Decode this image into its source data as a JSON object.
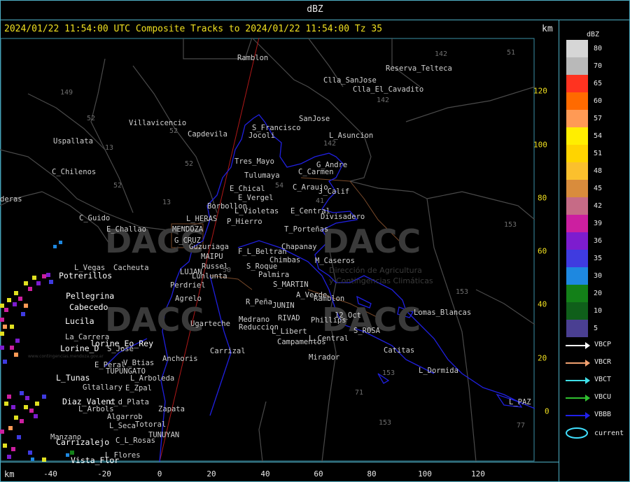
{
  "window": {
    "title": "dBZ"
  },
  "header": {
    "title": "2024/01/22 11:54:00 UTC Composite Tracks to 2024/01/22 11:54:00 Tz 35",
    "unit": "km"
  },
  "axes": {
    "x_unit": "km",
    "x_ticks": [
      "-40",
      "-20",
      "0",
      "20",
      "40",
      "60",
      "80",
      "100",
      "120"
    ],
    "y_ticks": [
      "120",
      "100",
      "80",
      "60",
      "40",
      "20",
      "0"
    ]
  },
  "legend": {
    "unit": "dBZ",
    "scale": [
      {
        "label": "80",
        "color": "#d6d6d6"
      },
      {
        "label": "70",
        "color": "#b9b9b9"
      },
      {
        "label": "65",
        "color": "#ff3320"
      },
      {
        "label": "60",
        "color": "#ff6a00"
      },
      {
        "label": "57",
        "color": "#ff9a55"
      },
      {
        "label": "54",
        "color": "#ffee00"
      },
      {
        "label": "51",
        "color": "#ffd400"
      },
      {
        "label": "48",
        "color": "#fbc02d"
      },
      {
        "label": "45",
        "color": "#d98c3c"
      },
      {
        "label": "42",
        "color": "#c66b86"
      },
      {
        "label": "39",
        "color": "#cc1fa0"
      },
      {
        "label": "36",
        "color": "#7d1ccf"
      },
      {
        "label": "35",
        "color": "#3f3be0"
      },
      {
        "label": "30",
        "color": "#1e88e0"
      },
      {
        "label": "20",
        "color": "#138018"
      },
      {
        "label": "10",
        "color": "#0f5f1a"
      },
      {
        "label": "5",
        "color": "#4a3f92"
      }
    ],
    "tracks": [
      {
        "label": "VBCP",
        "color": "#ffffff"
      },
      {
        "label": "VBCR",
        "color": "#f0a070"
      },
      {
        "label": "VBCT",
        "color": "#40e0e8"
      },
      {
        "label": "VBCU",
        "color": "#30c030"
      },
      {
        "label": "VBBB",
        "color": "#2020e8"
      }
    ],
    "current": {
      "label": "current",
      "color": "#40e0ff"
    }
  },
  "watermarks": {
    "name": "DACC",
    "line1": "Dirección de Agricultura",
    "line2": "y Contingencias Climáticas",
    "url": "www.contingencias.mendoza.gov.ar"
  },
  "places": [
    {
      "name": "Ramblon"
    },
    {
      "name": "Reserva_Telteca"
    },
    {
      "name": "Clla_SanJose"
    },
    {
      "name": "Clla_El_Cavadito"
    },
    {
      "name": "Villavicencio"
    },
    {
      "name": "Capdevila"
    },
    {
      "name": "SanJose"
    },
    {
      "name": "S_Francisco"
    },
    {
      "name": "Jocoli"
    },
    {
      "name": "L_Asuncion"
    },
    {
      "name": "Uspallata"
    },
    {
      "name": "Tres_Mayo"
    },
    {
      "name": "G_Andre"
    },
    {
      "name": "C_Carmen"
    },
    {
      "name": "Tulumaya"
    },
    {
      "name": "C_Chilenos"
    },
    {
      "name": "E_Chical"
    },
    {
      "name": "E_Vergel"
    },
    {
      "name": "C_Araujo"
    },
    {
      "name": "J_Calif"
    },
    {
      "name": "deras"
    },
    {
      "name": "Borbollon"
    },
    {
      "name": "L_Violetas"
    },
    {
      "name": "E_Central"
    },
    {
      "name": "C_Guido"
    },
    {
      "name": "L_HERAS"
    },
    {
      "name": "P_Hierro"
    },
    {
      "name": "Divisadero"
    },
    {
      "name": "E_Challao"
    },
    {
      "name": "MENDOZA"
    },
    {
      "name": "T_Porteñas"
    },
    {
      "name": "G_CRUZ"
    },
    {
      "name": "Guzuriaga"
    },
    {
      "name": "Chapanay"
    },
    {
      "name": "MAIPU"
    },
    {
      "name": "F_L_Beltran"
    },
    {
      "name": "Chimbas"
    },
    {
      "name": "Potrerillos"
    },
    {
      "name": "Russel"
    },
    {
      "name": "M_Caseros"
    },
    {
      "name": "L_Vegas"
    },
    {
      "name": "Cacheuta"
    },
    {
      "name": "LUJAN"
    },
    {
      "name": "S_Roque"
    },
    {
      "name": "Lunlunta"
    },
    {
      "name": "Palmira"
    },
    {
      "name": "Perdriel"
    },
    {
      "name": "S_MARTIN"
    },
    {
      "name": "Pellegrina"
    },
    {
      "name": "Agrelo"
    },
    {
      "name": "A_Verde"
    },
    {
      "name": "Ramblon"
    },
    {
      "name": "Cabecedo"
    },
    {
      "name": "R_Peña"
    },
    {
      "name": "JUNIN"
    },
    {
      "name": "Lomas_Blancas"
    },
    {
      "name": "Lucila"
    },
    {
      "name": "Medrano"
    },
    {
      "name": "RIVAD"
    },
    {
      "name": "12_Oct"
    },
    {
      "name": "Ugarteche"
    },
    {
      "name": "Reduccion"
    },
    {
      "name": "Phillips"
    },
    {
      "name": "S_ROSA"
    },
    {
      "name": "L_Libert"
    },
    {
      "name": "La_Carrera"
    },
    {
      "name": "L_Central"
    },
    {
      "name": "Campamentos"
    },
    {
      "name": "Lorine_D"
    },
    {
      "name": "lorine_Eo_Rey"
    },
    {
      "name": "S_Jose"
    },
    {
      "name": "Carrizal"
    },
    {
      "name": "Catitas"
    },
    {
      "name": "Mirador"
    },
    {
      "name": "E_Peral"
    },
    {
      "name": "V_Btias"
    },
    {
      "name": "Anchoris"
    },
    {
      "name": "TUPUNGATO"
    },
    {
      "name": "L_Dormida"
    },
    {
      "name": "L_Tunas"
    },
    {
      "name": "L_Arboleda"
    },
    {
      "name": "Gltallary"
    },
    {
      "name": "E_Zpal"
    },
    {
      "name": "Diaz_Valent"
    },
    {
      "name": "c_d_Plata"
    },
    {
      "name": "L_Arbols"
    },
    {
      "name": "Zapata"
    },
    {
      "name": "L_PAZ"
    },
    {
      "name": "Algarrob"
    },
    {
      "name": "Manzano"
    },
    {
      "name": "L_Seca"
    },
    {
      "name": "Totoral"
    },
    {
      "name": "Carrizalejo"
    },
    {
      "name": "C_L_Rosas"
    },
    {
      "name": "TUNUYAN"
    },
    {
      "name": "L_Flores"
    },
    {
      "name": "Vista_Flor"
    }
  ],
  "numbers": [
    "142",
    "51",
    "149",
    "142",
    "52",
    "52",
    "13",
    "142",
    "52",
    "52",
    "13",
    "54",
    "41",
    "153",
    "50",
    "153",
    "71",
    "153",
    "153",
    "77"
  ]
}
